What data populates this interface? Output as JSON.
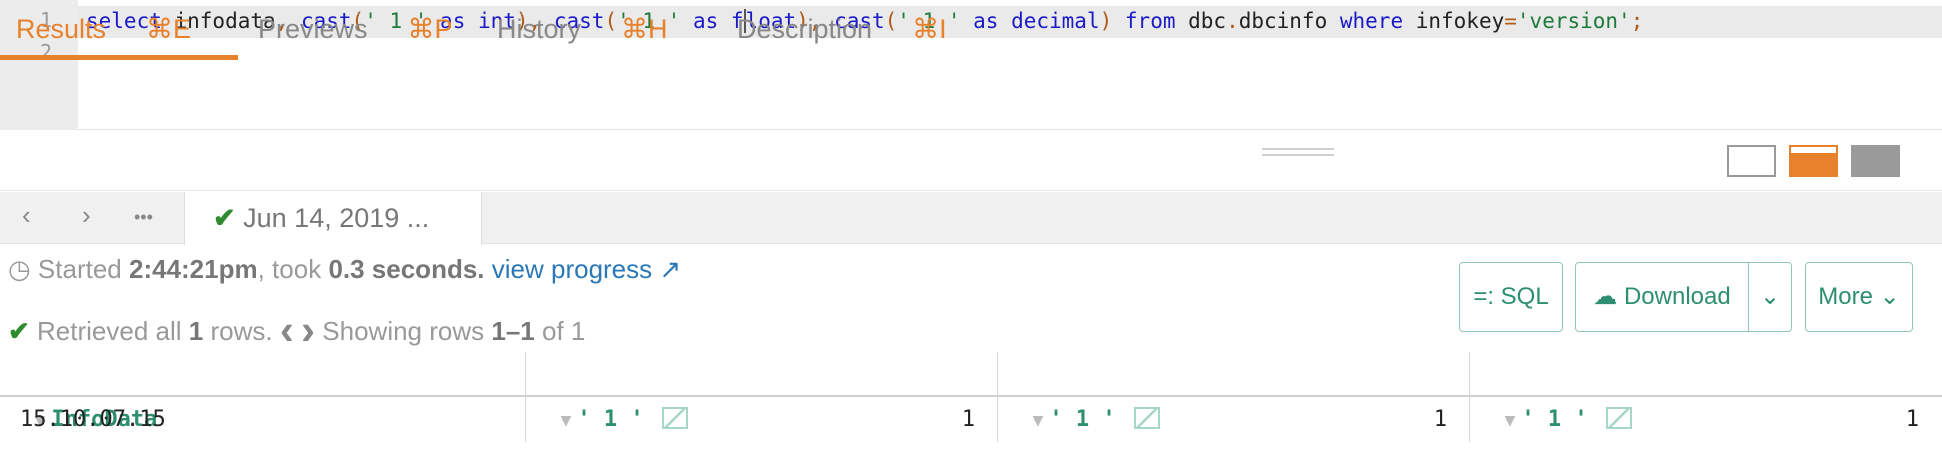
{
  "editor": {
    "line_numbers": [
      "1",
      "2"
    ],
    "tokens": [
      {
        "t": "select",
        "c": "kw"
      },
      {
        "t": " infodata",
        "c": ""
      },
      {
        "t": ",",
        "c": "op"
      },
      {
        "t": " cast",
        "c": "kw"
      },
      {
        "t": "(",
        "c": "op"
      },
      {
        "t": "' 1 '",
        "c": "str"
      },
      {
        "t": " as",
        "c": "kw"
      },
      {
        "t": " int",
        "c": "kw"
      },
      {
        "t": "),",
        "c": "op"
      },
      {
        "t": " cast",
        "c": "kw"
      },
      {
        "t": "(",
        "c": "op"
      },
      {
        "t": "' 1 '",
        "c": "str"
      },
      {
        "t": " as",
        "c": "kw"
      },
      {
        "t": " f",
        "c": "kw"
      },
      {
        "t": "CARET",
        "c": "caret"
      },
      {
        "t": "loat",
        "c": "kw"
      },
      {
        "t": "),",
        "c": "op"
      },
      {
        "t": " cast",
        "c": "kw"
      },
      {
        "t": "(",
        "c": "op"
      },
      {
        "t": "' 1 '",
        "c": "str"
      },
      {
        "t": " as",
        "c": "kw"
      },
      {
        "t": " decimal",
        "c": "kw"
      },
      {
        "t": ")",
        "c": "op"
      },
      {
        "t": " from",
        "c": "kw"
      },
      {
        "t": " dbc",
        "c": ""
      },
      {
        "t": ".",
        "c": "op"
      },
      {
        "t": "dbcinfo",
        "c": ""
      },
      {
        "t": " where",
        "c": "kw"
      },
      {
        "t": " infokey",
        "c": ""
      },
      {
        "t": "=",
        "c": "op"
      },
      {
        "t": "'version'",
        "c": "str"
      },
      {
        "t": ";",
        "c": "op"
      }
    ]
  },
  "tabs": [
    {
      "label": "Results",
      "shortcut": "⌘E"
    },
    {
      "label": "Previews",
      "shortcut": "⌘P"
    },
    {
      "label": "History",
      "shortcut": "⌘H"
    },
    {
      "label": "Description",
      "shortcut": "⌘I"
    }
  ],
  "subnav": {
    "prev_icon": "‹",
    "next_icon": "›",
    "more_icon": "•••",
    "tab_check": "✔",
    "tab_label": "Jun 14, 2019 ..."
  },
  "status": {
    "clock_icon": "◷",
    "started_prefix": "Started ",
    "started_time": "2:44:21pm",
    "took_prefix": ", took ",
    "took_value": "0.3 seconds.",
    "progress_link": "view progress",
    "external_icon": "↗",
    "retrieved_prefix": "Retrieved all ",
    "retrieved_count": "1",
    "retrieved_suffix": " rows.",
    "prev_page": "‹",
    "next_page": "›",
    "showing_prefix": "Showing rows ",
    "showing_range": "1–1",
    "showing_suffix": "of 1"
  },
  "actions": {
    "sql": "=: SQL",
    "download_icon": "☁",
    "download": "Download",
    "download_caret": "⌄",
    "more": "More ⌄"
  },
  "table": {
    "columns": [
      "InfoData",
      "' 1 '",
      "' 1 '",
      "' 1 '"
    ],
    "rows": [
      [
        "15.10.07.15",
        "1",
        "1",
        "1"
      ]
    ]
  },
  "colors": {
    "accent": "#e8812b",
    "link": "#2a78b8",
    "header": "#2e8f70"
  }
}
